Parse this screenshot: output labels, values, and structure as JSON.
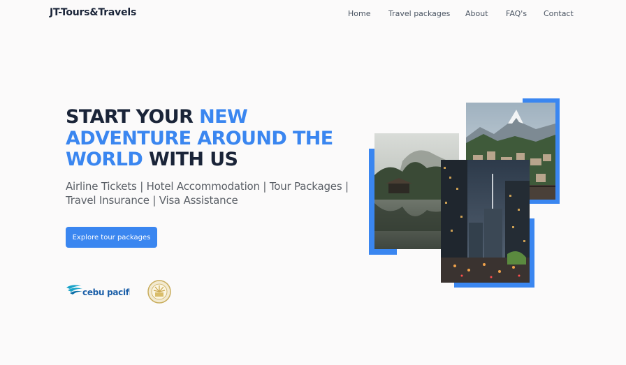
{
  "header": {
    "brand": "JT-Tours&Travels",
    "nav": [
      {
        "label": "Home"
      },
      {
        "label": "Travel packages"
      },
      {
        "label": "About"
      },
      {
        "label": "FAQ's"
      },
      {
        "label": "Contact"
      }
    ]
  },
  "hero": {
    "title_part1": "START YOUR ",
    "title_accent": "NEW ADVENTURE AROUND THE WORLD",
    "title_part2": " WITH US",
    "subtitle": "Airline Tickets | Hotel Accommodation | Tour Packages | Travel Insurance | Visa Assistance",
    "cta_label": "Explore tour packages"
  },
  "partners": {
    "cebu_logo_text": "cebu pacific"
  },
  "colors": {
    "accent": "#3a86f0",
    "heading": "#1a2438",
    "background": "#fbfafa"
  },
  "images": [
    {
      "name": "mountain-village-photo"
    },
    {
      "name": "lake-pagoda-photo"
    },
    {
      "name": "city-night-photo"
    }
  ]
}
